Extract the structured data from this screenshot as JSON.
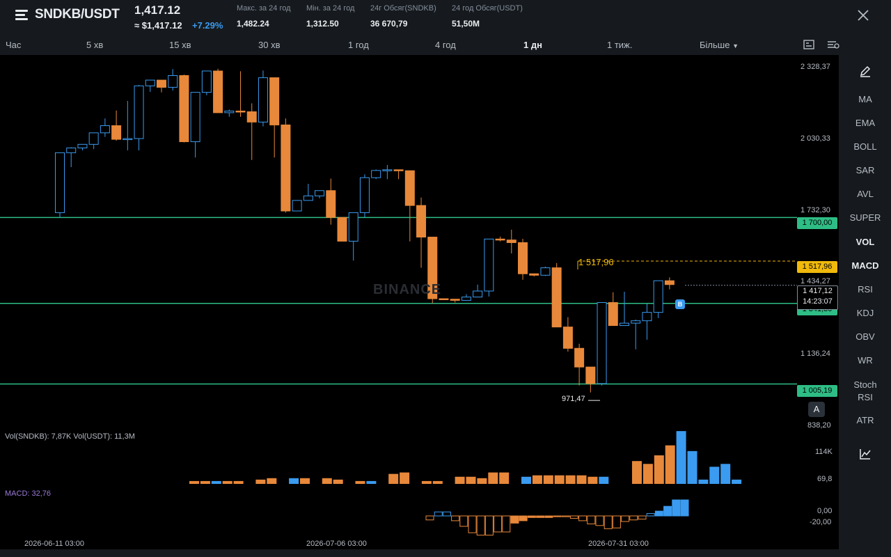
{
  "header": {
    "pair": "SNDKB/USDT",
    "price": "1,417.12",
    "usd_price": "≈ $1,417.12",
    "change": "+7.29%",
    "stats": [
      {
        "label": "Макс. за 24 год",
        "value": "1,482.24"
      },
      {
        "label": "Мін. за 24 год",
        "value": "1,312.50"
      },
      {
        "label": "24г Обсяг(SNDKB)",
        "value": "36 670,79"
      },
      {
        "label": "24 год Обсяг(USDT)",
        "value": "51,50M"
      }
    ]
  },
  "timeframes": [
    "Час",
    "5 хв",
    "15 хв",
    "30 хв",
    "1 год",
    "4 год",
    "1 дн",
    "1 тиж.",
    "Більше"
  ],
  "active_timeframe": "1 дн",
  "indicators": [
    "MA",
    "EMA",
    "BOLL",
    "SAR",
    "AVL",
    "SUPER",
    "VOL",
    "MACD",
    "RSI",
    "KDJ",
    "OBV",
    "WR",
    "Stoch RSI",
    "ATR"
  ],
  "active_indicators": [
    "VOL",
    "MACD"
  ],
  "icons": {
    "menu": "menu-icon",
    "close": "close-icon",
    "pencil": "pencil-icon",
    "chart_settings": "chart-settings-icon",
    "chart_type": "chart-type-icon",
    "line_chart": "line-chart-icon"
  },
  "colors": {
    "up": "#3a9bf0",
    "down": "#e8883a",
    "level": "#2ebd85",
    "highlight": "#f0b90b"
  },
  "chart": {
    "watermark": "BINANCE",
    "price_axis": [
      "2 328,37",
      "2 030,33",
      "1 732,30",
      "1 434,27",
      "1 136,24",
      "838,20"
    ],
    "levels": [
      "1 700,00",
      "1 341,30",
      "1 005,19"
    ],
    "highlight_level": "1 517,96",
    "current_price": "1 417,12",
    "countdown": "14:23:07",
    "low_label": "971,47",
    "auto_button": "A",
    "buy_marker": "B",
    "time_axis": [
      "2026-06-11 03:00",
      "2026-07-06 03:00",
      "2026-07-31 03:00"
    ],
    "volume_label": "Vol(SNDKB): 7,87K   Vol(USDT): 11,3M",
    "volume_axis": [
      "114K",
      "69,8"
    ],
    "macd_label": "MACD: 32,76",
    "macd_axis": [
      "0,00",
      "-20,00"
    ]
  },
  "chart_data": {
    "type": "candlestick",
    "candles": [
      [
        1720,
        1970,
        1700,
        1970
      ],
      [
        1970,
        1993,
        1910,
        1990
      ],
      [
        1990,
        2005,
        1980,
        2005
      ],
      [
        2005,
        2053,
        1985,
        2053
      ],
      [
        2053,
        2113,
        2036,
        2083
      ],
      [
        2083,
        2146,
        2020,
        2026
      ],
      [
        2026,
        2186,
        1980,
        2029
      ],
      [
        2029,
        2253,
        1980,
        2249
      ],
      [
        2249,
        2270,
        2224,
        2273
      ],
      [
        2273,
        2273,
        2222,
        2243
      ],
      [
        2243,
        2319,
        2230,
        2292
      ],
      [
        2292,
        2296,
        2013,
        2016
      ],
      [
        2016,
        2210,
        1950,
        2222
      ],
      [
        2222,
        2307,
        2210,
        2311
      ],
      [
        2311,
        2320,
        2137,
        2137
      ],
      [
        2137,
        2150,
        2120,
        2144
      ],
      [
        2144,
        2310,
        2120,
        2141
      ],
      [
        2141,
        2176,
        1940,
        2098
      ],
      [
        2098,
        2313,
        2080,
        2283
      ],
      [
        2283,
        2284,
        1950,
        2086
      ],
      [
        2086,
        2113,
        1720,
        1727
      ],
      [
        1727,
        1744,
        1760,
        1771
      ],
      [
        1771,
        1840,
        1770,
        1790
      ],
      [
        1790,
        1806,
        1780,
        1812
      ],
      [
        1812,
        1862,
        1670,
        1700
      ],
      [
        1700,
        1666,
        1604,
        1601
      ],
      [
        1601,
        1627,
        1520,
        1720
      ],
      [
        1720,
        1880,
        1700,
        1866
      ],
      [
        1866,
        1900,
        1860,
        1896
      ],
      [
        1896,
        1919,
        1860,
        1899
      ],
      [
        1899,
        1900,
        1860,
        1895
      ],
      [
        1895,
        1896,
        1600,
        1750
      ],
      [
        1750,
        1783,
        1490,
        1618
      ],
      [
        1618,
        1602,
        1342,
        1361
      ],
      [
        1361,
        1350,
        1357,
        1359
      ],
      [
        1359,
        1343,
        1345,
        1354
      ],
      [
        1354,
        1380,
        1360,
        1368
      ],
      [
        1368,
        1420,
        1380,
        1393
      ],
      [
        1393,
        1505,
        1370,
        1610
      ],
      [
        1610,
        1620,
        1600,
        1606
      ],
      [
        1606,
        1649,
        1550,
        1595
      ],
      [
        1595,
        1611,
        1440,
        1465
      ],
      [
        1465,
        1466,
        1454,
        1459
      ],
      [
        1459,
        1495,
        1456,
        1490
      ],
      [
        1490,
        1510,
        1300,
        1243
      ],
      [
        1243,
        1284,
        1140,
        1154
      ],
      [
        1154,
        1173,
        999,
        1076
      ],
      [
        1076,
        1067,
        970,
        1007
      ],
      [
        1007,
        1334,
        999,
        1345
      ],
      [
        1345,
        1388,
        1260,
        1249
      ],
      [
        1249,
        1390,
        1250,
        1259
      ],
      [
        1259,
        1274,
        1150,
        1269
      ],
      [
        1269,
        1341,
        1190,
        1304
      ],
      [
        1304,
        1434,
        1280,
        1436
      ],
      [
        1436,
        1450,
        1400,
        1420
      ]
    ],
    "ylim": [
      838.2,
      2328.37
    ],
    "volume": [
      2,
      2,
      2,
      2,
      2,
      0,
      3,
      4,
      0,
      4,
      4,
      0,
      4,
      3,
      0,
      2,
      2,
      0,
      7,
      8,
      0,
      2,
      2,
      0,
      5,
      5,
      4,
      8,
      8,
      0,
      5,
      6,
      6,
      6,
      6,
      6,
      5,
      5,
      0,
      0,
      16,
      14,
      20,
      27,
      37,
      23,
      3,
      12,
      14,
      3
    ],
    "macd": [
      -5,
      5,
      5,
      -6,
      -13,
      -21,
      -24,
      -24,
      -20,
      -20,
      -9,
      -6,
      -2,
      -2,
      -2,
      -1,
      -1,
      -3,
      -6,
      -10,
      -12,
      -16,
      -15,
      -7,
      -5,
      -4,
      3,
      6,
      12,
      20,
      20
    ]
  }
}
